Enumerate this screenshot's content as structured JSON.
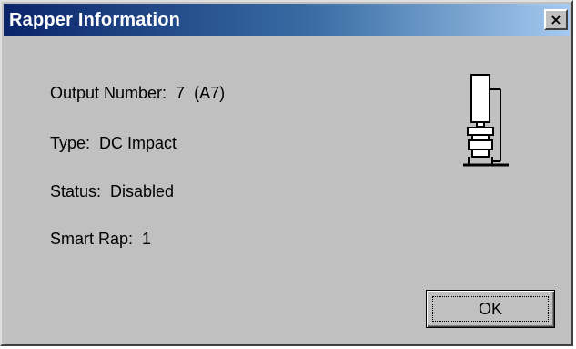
{
  "window": {
    "title": "Rapper Information",
    "close_glyph": "×",
    "close_icon": "close-icon"
  },
  "info": {
    "output_number": "Output Number:  7  (A7)",
    "type": "Type:  DC Impact",
    "status": "Status:  Disabled",
    "smart_rap": "Smart Rap:  1"
  },
  "icon": {
    "name": "rapper-device-icon"
  },
  "buttons": {
    "ok_label": "OK"
  },
  "colors": {
    "title_bar_start": "#0a246a",
    "title_bar_end": "#a6caf0",
    "dialog_face": "#c0c0c0"
  }
}
